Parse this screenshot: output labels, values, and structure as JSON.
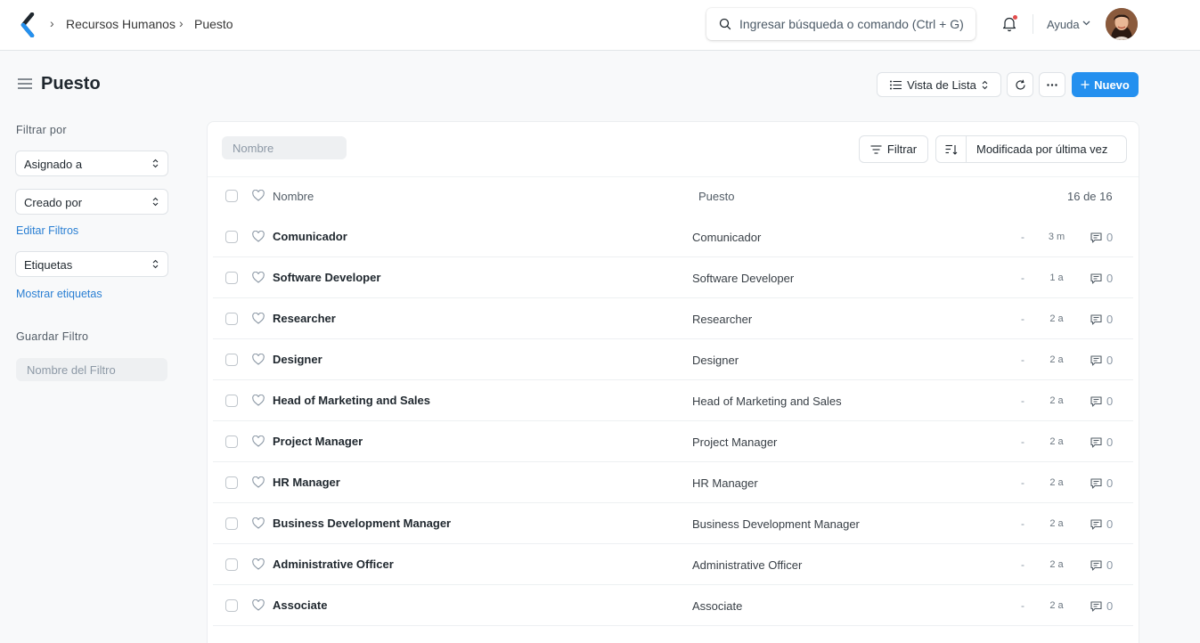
{
  "breadcrumbs": [
    "Recursos Humanos",
    "Puesto"
  ],
  "search": {
    "placeholder": "Ingresar búsqueda o comando (Ctrl + G)"
  },
  "navbar": {
    "help_label": "Ayuda"
  },
  "page": {
    "title": "Puesto"
  },
  "toolbar": {
    "view_label": "Vista de Lista",
    "new_label": "Nuevo"
  },
  "sidebar": {
    "filter_by_label": "Filtrar por",
    "assigned_to_label": "Asignado a",
    "created_by_label": "Creado por",
    "edit_filters_label": "Editar Filtros",
    "tags_label": "Etiquetas",
    "show_tags_label": "Mostrar etiquetas",
    "save_filter_label": "Guardar Filtro",
    "filter_name_placeholder": "Nombre del Filtro"
  },
  "list": {
    "name_filter_placeholder": "Nombre",
    "filter_label": "Filtrar",
    "sort_label": "Modificada por última vez",
    "columns": {
      "name": "Nombre",
      "job": "Puesto"
    },
    "count_label": "16 de 16",
    "rows": [
      {
        "name": "Comunicador",
        "job": "Comunicador",
        "dash": "-",
        "time": "3 m",
        "comments": "0"
      },
      {
        "name": "Software Developer",
        "job": "Software Developer",
        "dash": "-",
        "time": "1 a",
        "comments": "0"
      },
      {
        "name": "Researcher",
        "job": "Researcher",
        "dash": "-",
        "time": "2 a",
        "comments": "0"
      },
      {
        "name": "Designer",
        "job": "Designer",
        "dash": "-",
        "time": "2 a",
        "comments": "0"
      },
      {
        "name": "Head of Marketing and Sales",
        "job": "Head of Marketing and Sales",
        "dash": "-",
        "time": "2 a",
        "comments": "0"
      },
      {
        "name": "Project Manager",
        "job": "Project Manager",
        "dash": "-",
        "time": "2 a",
        "comments": "0"
      },
      {
        "name": "HR Manager",
        "job": "HR Manager",
        "dash": "-",
        "time": "2 a",
        "comments": "0"
      },
      {
        "name": "Business Development Manager",
        "job": "Business Development Manager",
        "dash": "-",
        "time": "2 a",
        "comments": "0"
      },
      {
        "name": "Administrative Officer",
        "job": "Administrative Officer",
        "dash": "-",
        "time": "2 a",
        "comments": "0"
      },
      {
        "name": "Associate",
        "job": "Associate",
        "dash": "-",
        "time": "2 a",
        "comments": "0"
      }
    ]
  },
  "colors": {
    "primary": "#2490ef",
    "link": "#2a7fd3",
    "text": "#1f272e",
    "notification_dot": "#e24c4c"
  }
}
